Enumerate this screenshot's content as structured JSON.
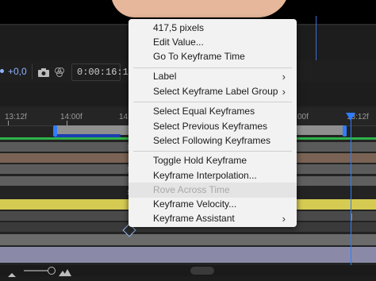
{
  "colors": {
    "accent_blue": "#2f7cff",
    "green_bar": "#2db34a",
    "menu_bg": "#f2f2f2"
  },
  "toolbar": {
    "offset_value": "+0,0",
    "camera_icon": "camera-icon",
    "timecode": "0:00:16:11"
  },
  "ruler": {
    "ticks": [
      "13:12f",
      "14:00f",
      "14",
      "00f",
      "13:12f"
    ]
  },
  "tracks": [
    {
      "color": "#5a5a5a"
    },
    {
      "color": "#7a6354"
    },
    {
      "color": "#5c5c5c"
    },
    {
      "color": "#5f5f5f"
    },
    {
      "color": "#d6cb52"
    },
    {
      "color": "#4a4a4a"
    },
    {
      "color": "#3a3a3a"
    },
    {
      "color": "#6b6b6b"
    },
    {
      "color": "#8a8aa8"
    }
  ],
  "context_menu": {
    "items": [
      {
        "label": "417,5 pixels",
        "submenu": false,
        "disabled": false
      },
      {
        "label": "Edit Value...",
        "submenu": false,
        "disabled": false
      },
      {
        "label": "Go To Keyframe Time",
        "submenu": false,
        "disabled": false
      },
      {
        "label": "Label",
        "submenu": true,
        "disabled": false
      },
      {
        "label": "Select Keyframe Label Group",
        "submenu": true,
        "disabled": false
      },
      {
        "label": "Select Equal Keyframes",
        "submenu": false,
        "disabled": false
      },
      {
        "label": "Select Previous Keyframes",
        "submenu": false,
        "disabled": false
      },
      {
        "label": "Select Following Keyframes",
        "submenu": false,
        "disabled": false
      },
      {
        "label": "Toggle Hold Keyframe",
        "submenu": false,
        "disabled": false
      },
      {
        "label": "Keyframe Interpolation...",
        "submenu": false,
        "disabled": false
      },
      {
        "label": "Rove Across Time",
        "submenu": false,
        "disabled": true
      },
      {
        "label": "Keyframe Velocity...",
        "submenu": false,
        "disabled": false
      },
      {
        "label": "Keyframe Assistant",
        "submenu": true,
        "disabled": false
      }
    ]
  }
}
